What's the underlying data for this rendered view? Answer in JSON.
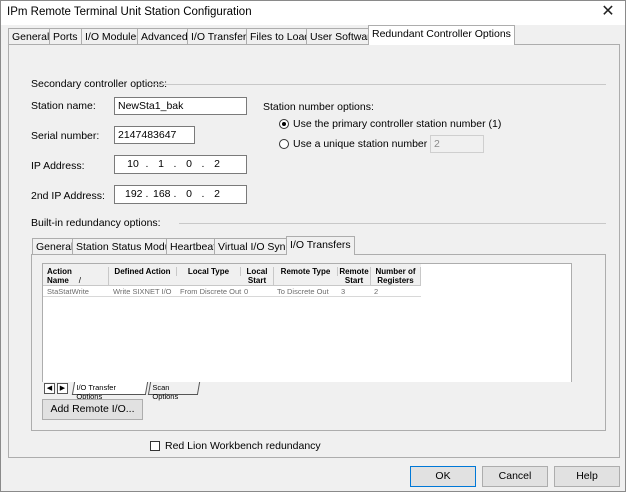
{
  "window": {
    "title": "IPm Remote Terminal Unit Station Configuration",
    "close_glyph": "✕"
  },
  "main_tabs": [
    "General",
    "Ports",
    "I/O Modules",
    "Advanced",
    "I/O Transfers",
    "Files to Load",
    "User Software",
    "Redundant Controller Options"
  ],
  "secondary": {
    "label": "Secondary controller options:",
    "station_name_label": "Station name:",
    "station_name": "NewSta1_bak",
    "serial_label": "Serial number:",
    "serial": "2147483647",
    "ip_label": "IP Address:",
    "ip": [
      "10",
      ".",
      "1",
      ".",
      "0",
      ".",
      "2"
    ],
    "ip2_label": "2nd IP Address:",
    "ip2": [
      "192",
      ".",
      "168",
      ".",
      "0",
      ".",
      "2"
    ]
  },
  "station_number": {
    "label": "Station number options:",
    "opt_primary": "Use the primary controller station number (1)",
    "opt_unique": "Use a unique station number",
    "unique_value": "2"
  },
  "builtin": {
    "label": "Built-in redundancy options:",
    "tabs": [
      "General",
      "Station Status Module",
      "Heartbeat",
      "Virtual I/O Synch",
      "I/O Transfers"
    ]
  },
  "table": {
    "headers": [
      "Action Name",
      "Defined Action",
      "Local Type",
      "Local Start",
      "Remote Type",
      "Remote Start",
      "Number of Registers"
    ],
    "sort_glyph": "/",
    "row": [
      "StaStatWrite",
      "Write SIXNET I/O",
      "From Discrete Out",
      "0",
      "To Discrete Out",
      "3",
      "2"
    ]
  },
  "sheet_tabs": [
    "I/O Transfer Options",
    "Scan Options"
  ],
  "add_remote_button": "Add Remote I/O...",
  "redlion_label": "Red Lion Workbench redundancy",
  "buttons": {
    "ok": "OK",
    "cancel": "Cancel",
    "help": "Help"
  },
  "colors": {
    "accent": "#0078d7"
  }
}
